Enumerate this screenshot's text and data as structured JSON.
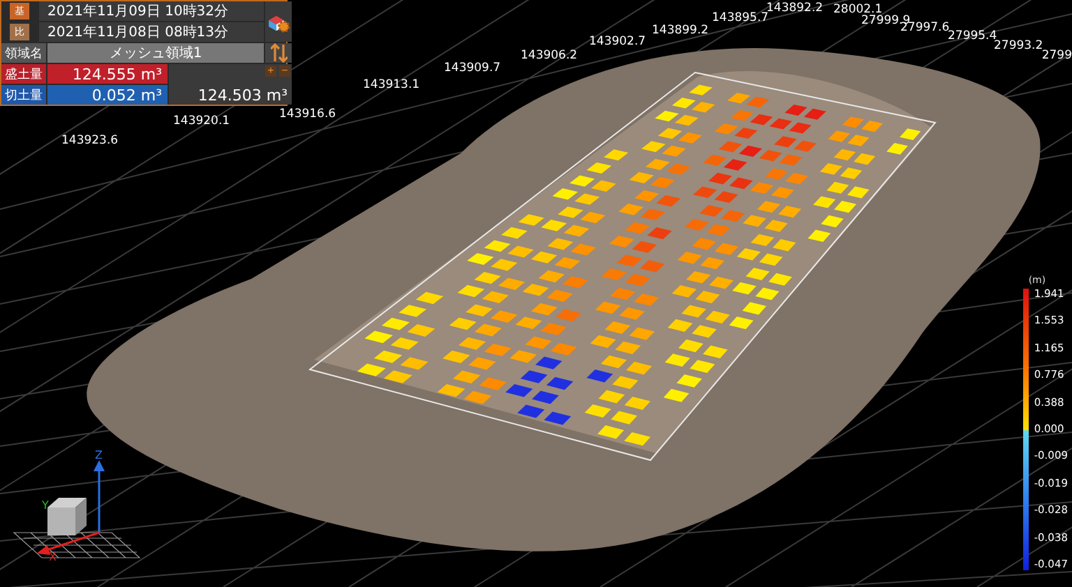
{
  "panel": {
    "base": {
      "icon": "基",
      "date": "2021年11月09日 10時32分"
    },
    "compare": {
      "icon": "比",
      "date": "2021年11月08日 08時13分"
    },
    "area": {
      "label": "領域名",
      "value": "メッシュ領域1"
    },
    "fill": {
      "label": "盛土量",
      "value": "124.555 m³"
    },
    "cut": {
      "label": "切土量",
      "value": "0.052 m³"
    },
    "net": "124.503 m³",
    "zoom_buttons": [
      "+",
      "−"
    ]
  },
  "coordinate_labels": [
    "143923.6",
    "143920.1",
    "143916.6",
    "143913.1",
    "143909.7",
    "143906.2",
    "143902.7",
    "143899.2",
    "143895.7",
    "143892.2",
    "28002.1",
    "27999.9",
    "27997.6",
    "27995.4",
    "27993.2",
    "2799"
  ],
  "legend": {
    "unit": "(m)",
    "ticks": [
      "1.941",
      "1.553",
      "1.165",
      "0.776",
      "0.388",
      "0.000",
      "-0.009",
      "-0.019",
      "-0.028",
      "-0.038",
      "-0.047"
    ]
  },
  "gizmo": {
    "axes": [
      "X",
      "Y",
      "Z"
    ]
  }
}
